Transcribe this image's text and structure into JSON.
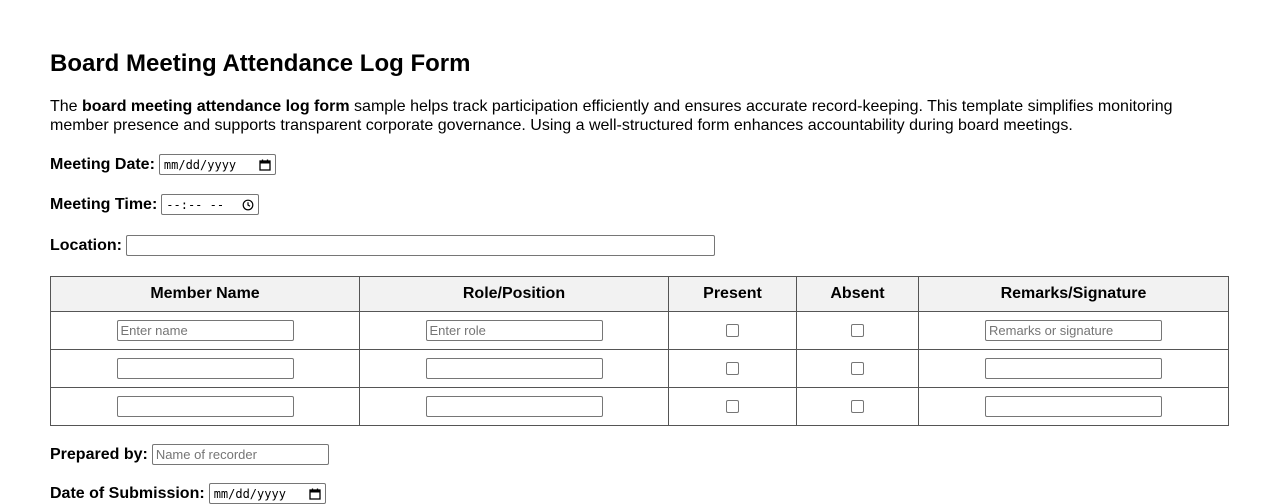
{
  "title": "Board Meeting Attendance Log Form",
  "intro": {
    "lead": "The ",
    "bold": "board meeting attendance log form",
    "rest": " sample helps track participation efficiently and ensures accurate record-keeping. This template simplifies monitoring member presence and supports transparent corporate governance. Using a well-structured form enhances accountability during board meetings."
  },
  "fields": {
    "meeting_date": {
      "label": "Meeting Date:",
      "value": "mm/dd/yyyy",
      "icon": "calendar-icon"
    },
    "meeting_time": {
      "label": "Meeting Time:",
      "value": "--:-- --",
      "icon": "clock-icon"
    },
    "location": {
      "label": "Location:",
      "value": "",
      "placeholder": ""
    },
    "prepared_by": {
      "label": "Prepared by:",
      "value": "",
      "placeholder": "Name of recorder"
    },
    "date_of_submission": {
      "label": "Date of Submission:",
      "value": "mm/dd/yyyy",
      "icon": "calendar-icon"
    }
  },
  "table": {
    "headers": [
      "Member Name",
      "Role/Position",
      "Present",
      "Absent",
      "Remarks/Signature"
    ],
    "rows": [
      {
        "name_placeholder": "Enter name",
        "role_placeholder": "Enter role",
        "present": false,
        "absent": false,
        "remarks_placeholder": "Remarks or signature"
      },
      {
        "name_placeholder": "",
        "role_placeholder": "",
        "present": false,
        "absent": false,
        "remarks_placeholder": ""
      },
      {
        "name_placeholder": "",
        "role_placeholder": "",
        "present": false,
        "absent": false,
        "remarks_placeholder": ""
      }
    ]
  }
}
